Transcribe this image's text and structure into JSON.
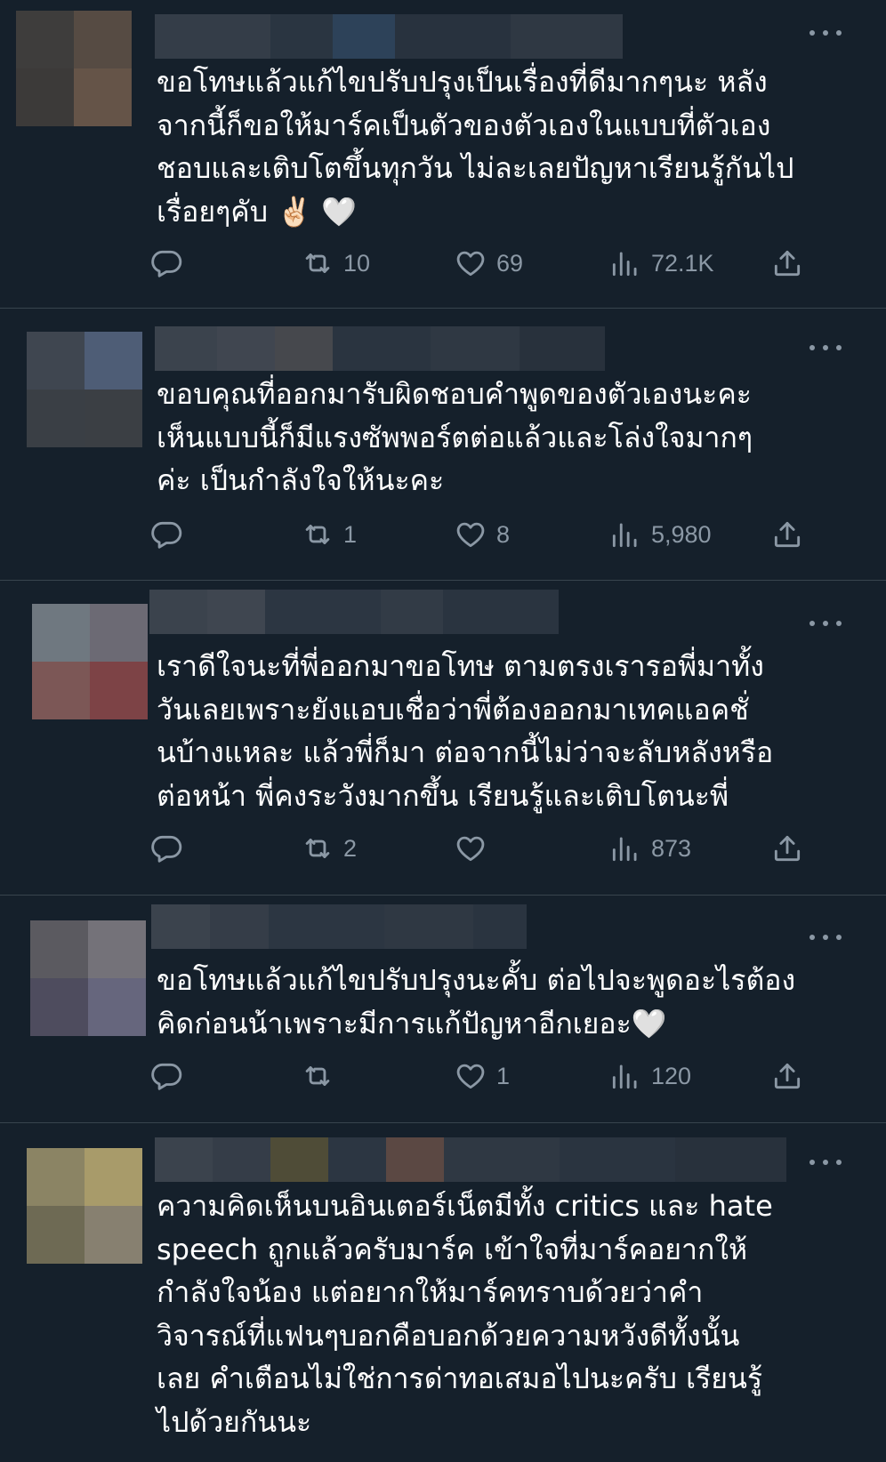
{
  "tweets": [
    {
      "lines": [
        "ขอโทษแล้วแก้ไขปรับปรุงเป็นเรื่องที่ดีมากๆนะ หลัง",
        "จากนี้ก็ขอให้มาร์คเป็นตัวของตัวเองในแบบที่ตัวเอง",
        "ชอบและเติบโตขึ้นทุกวัน ไม่ละเลยปัญหาเรียนรู้กันไป",
        "เรื่อยๆคับ ✌🏻 🤍"
      ],
      "retweets": "10",
      "likes": "69",
      "views": "72.1K"
    },
    {
      "lines": [
        "ขอบคุณที่ออกมารับผิดชอบคำพูดของตัวเองนะคะ",
        "เห็นแบบนี้ก็มีแรงซัพพอร์ตต่อแล้วและโล่งใจมากๆ",
        "ค่ะ เป็นกำลังใจให้นะคะ"
      ],
      "retweets": "1",
      "likes": "8",
      "views": "5,980"
    },
    {
      "lines": [
        "เราดีใจนะที่พี่ออกมาขอโทษ ตามตรงเรารอพี่มาทั้ง",
        "วันเลยเพราะยังแอบเชื่อว่าพี่ต้องออกมาเทคแอคชั่",
        "นบ้างแหละ แล้วพี่ก็มา ต่อจากนี้ไม่ว่าจะลับหลังหรือ",
        "ต่อหน้า พี่คงระวังมากขึ้น เรียนรู้และเติบโตนะพี่"
      ],
      "retweets": "2",
      "likes": "",
      "views": "873"
    },
    {
      "lines": [
        "ขอโทษแล้วแก้ไขปรับปรุงนะคั้บ ต่อไปจะพูดอะไรต้อง",
        "คิดก่อนน้าเพราะมีการแก้ปัญหาอีกเยอะ🤍"
      ],
      "retweets": "",
      "likes": "1",
      "views": "120"
    },
    {
      "lines": [
        "ความคิดเห็นบนอินเตอร์เน็ตมีทั้ง critics และ hate",
        "speech ถูกแล้วครับมาร์ค เข้าใจที่มาร์คอยากให้",
        "กำลังใจน้อง แต่อยากให้มาร์คทราบด้วยว่าคำ",
        "วิจารณ์ที่แฟนๆบอกคือบอกด้วยความหวังดีทั้งนั้น",
        "เลย คำเตือนไม่ใช่การด่าทอเสมอไปนะครับ เรียนรู้",
        "ไปด้วยกันนะ"
      ]
    }
  ],
  "icons": {
    "reply": "reply-icon",
    "retweet": "retweet-icon",
    "like": "heart-icon",
    "views": "views-icon",
    "share": "share-icon",
    "more": "more-icon"
  }
}
